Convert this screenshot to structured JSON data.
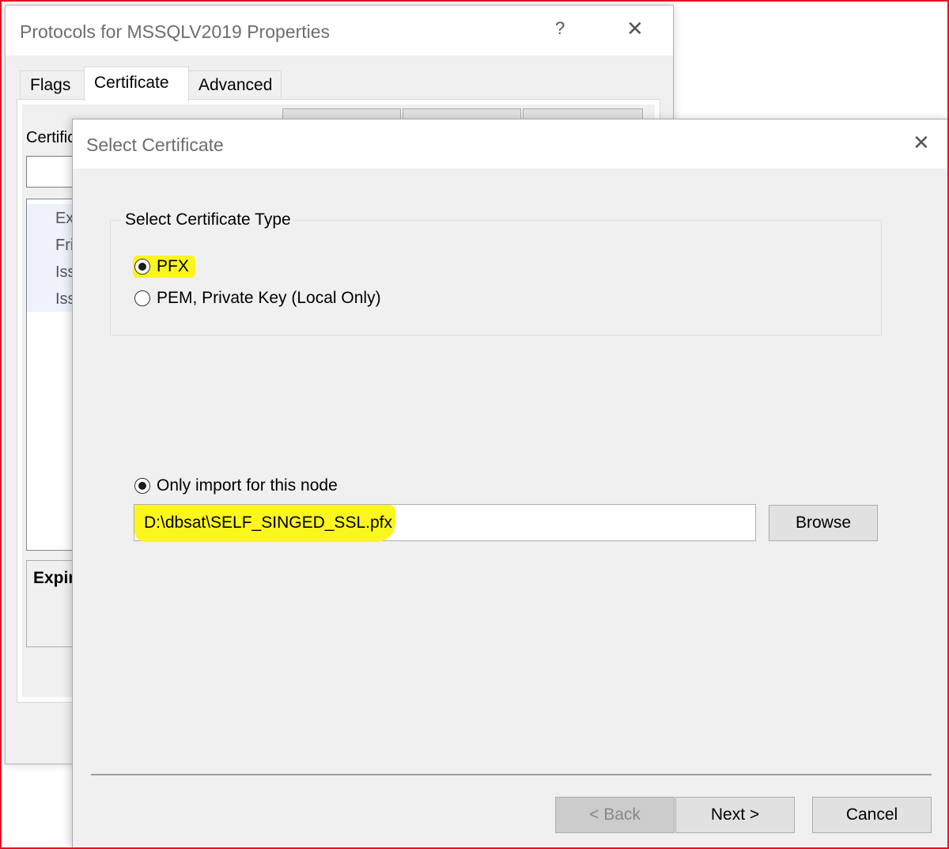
{
  "back_dialog": {
    "title": "Protocols for MSSQLV2019 Properties",
    "help_glyph": "?",
    "close_glyph": "✕",
    "tabs": [
      {
        "label": "Flags"
      },
      {
        "label": "Certificate"
      },
      {
        "label": "Advanced"
      }
    ],
    "certificate_label": "Certific",
    "list_rows": [
      "Ex",
      "Fri",
      "Iss",
      "Iss"
    ],
    "expiry_label": "Expir"
  },
  "front_dialog": {
    "title": "Select Certificate",
    "close_glyph": "✕",
    "group_title": "Select Certificate Type",
    "radio_pfx": {
      "label": "PFX",
      "checked": true
    },
    "radio_pem": {
      "label": "PEM, Private Key (Local Only)",
      "checked": false
    },
    "radio_node": {
      "label": "Only import for this node",
      "checked": true
    },
    "path_value": "D:\\dbsat\\SELF_SINGED_SSL.pfx",
    "browse_label": "Browse",
    "back_label": "< Back",
    "next_label": "Next >",
    "cancel_label": "Cancel"
  },
  "colors": {
    "highlight": "#faf61e",
    "screen_border": "#e81123"
  }
}
